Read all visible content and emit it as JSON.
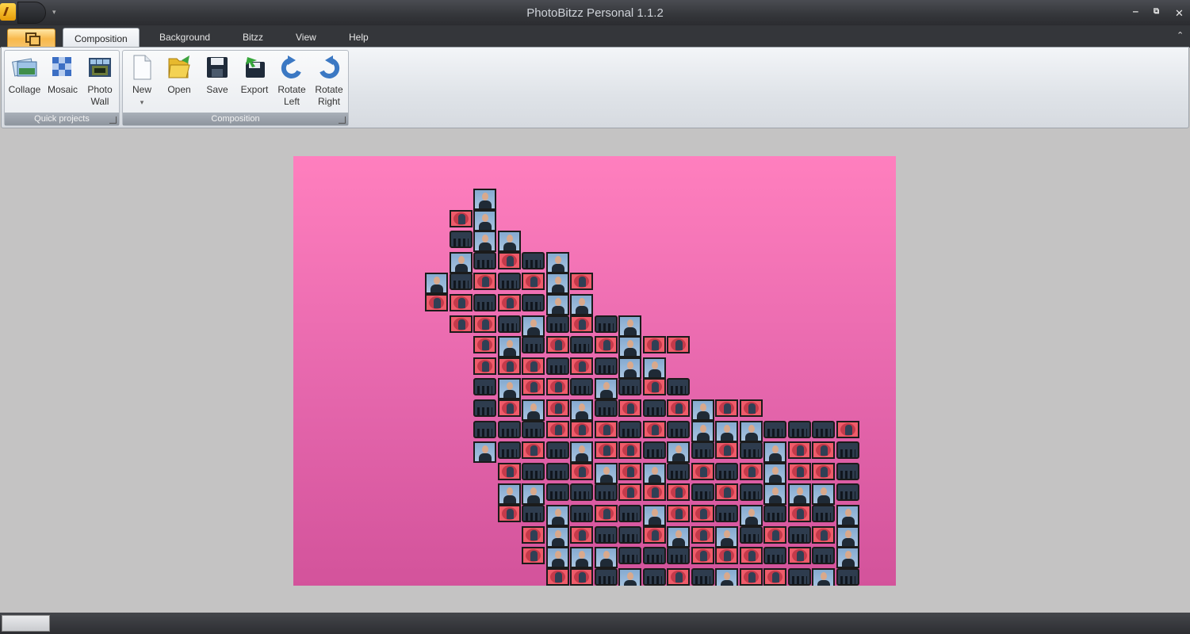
{
  "window": {
    "title": "PhotoBitzz Personal 1.1.2",
    "controls": {
      "minimize": "‒",
      "restore": "⧉",
      "close": "✕"
    }
  },
  "tabs": [
    {
      "label": "Composition",
      "active": true
    },
    {
      "label": "Background"
    },
    {
      "label": "Bitzz"
    },
    {
      "label": "View"
    },
    {
      "label": "Help"
    }
  ],
  "ribbon": {
    "quick_projects": {
      "label": "Quick projects",
      "buttons": [
        {
          "label": "Collage",
          "icon": "collage-icon"
        },
        {
          "label": "Mosaic",
          "icon": "mosaic-icon"
        },
        {
          "label": "Photo\nWall",
          "line1": "Photo",
          "line2": "Wall",
          "icon": "photo-wall-icon"
        }
      ]
    },
    "composition": {
      "label": "Composition",
      "buttons": [
        {
          "label": "New",
          "icon": "new-document-icon",
          "dropdown": "▾"
        },
        {
          "label": "Open",
          "icon": "open-folder-icon"
        },
        {
          "label": "Save",
          "icon": "floppy-disk-icon"
        },
        {
          "label": "Export",
          "icon": "export-icon"
        },
        {
          "label": "Rotate Left",
          "line1": "Rotate",
          "line2": "Left",
          "icon": "rotate-left-icon"
        },
        {
          "label": "Rotate Right",
          "line1": "Rotate",
          "line2": "Right",
          "icon": "rotate-right-icon"
        }
      ]
    }
  },
  "canvas": {
    "background_top": "#ff7fbe",
    "background_bottom": "#d3539b"
  },
  "colors": {
    "titlebar": "#34363a",
    "accent": "#f8b84b"
  }
}
